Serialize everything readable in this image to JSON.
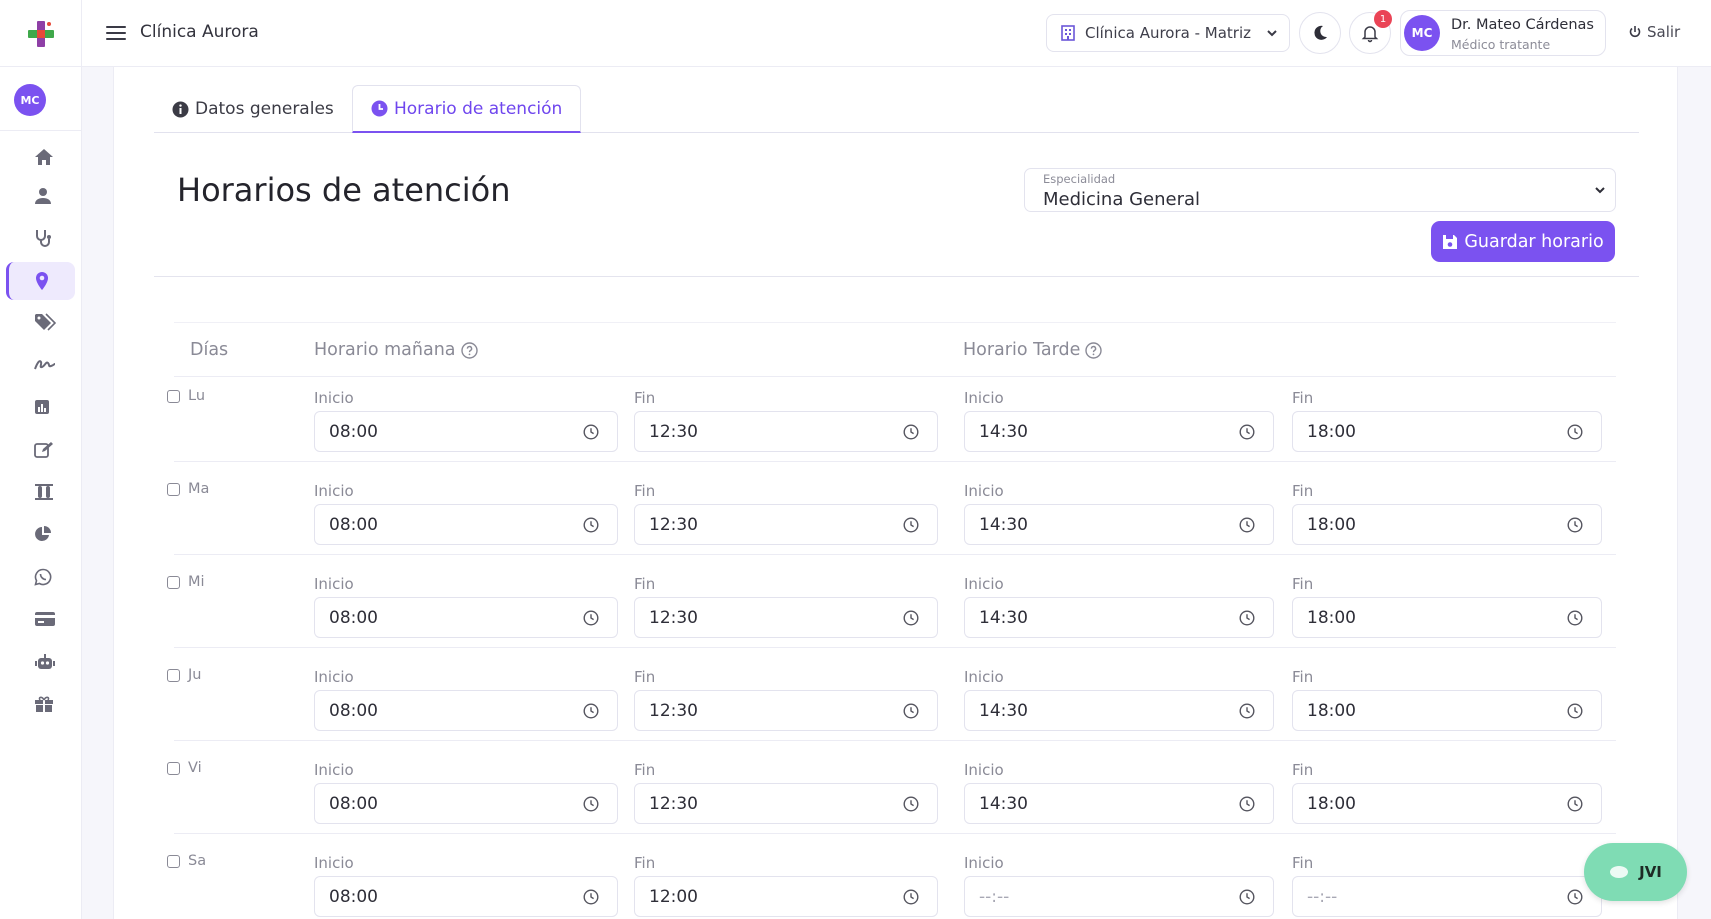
{
  "header": {
    "app_title": "Clínica Aurora",
    "branch": "Clínica Aurora - Matriz",
    "notification_count": "1",
    "user_initials": "MC",
    "user_name": "Dr. Mateo Cárdenas",
    "user_role": "Médico tratante",
    "logout_label": "Salir"
  },
  "sidebar": {
    "avatar_initials": "MC",
    "items": [
      {
        "icon": "home-icon"
      },
      {
        "icon": "user-icon"
      },
      {
        "icon": "stethoscope-icon"
      },
      {
        "icon": "location-pin-icon",
        "active": true
      },
      {
        "icon": "tags-icon"
      },
      {
        "icon": "signature-icon"
      },
      {
        "icon": "bar-chart-icon"
      },
      {
        "icon": "edit-icon"
      },
      {
        "icon": "test-tubes-icon"
      },
      {
        "icon": "pie-chart-icon"
      },
      {
        "icon": "whatsapp-icon"
      },
      {
        "icon": "credit-card-icon"
      },
      {
        "icon": "robot-icon"
      },
      {
        "icon": "gift-icon"
      }
    ]
  },
  "tabs": [
    {
      "label": "Datos generales",
      "icon": "info-icon"
    },
    {
      "label": "Horario de atención",
      "icon": "clock-icon",
      "active": true
    }
  ],
  "page_title": "Horarios de atención",
  "specialty": {
    "label": "Especialidad",
    "value": "Medicina General"
  },
  "save_label": "Guardar horario",
  "table": {
    "col_days": "Días",
    "col_morning": "Horario mañana",
    "col_afternoon": "Horario Tarde",
    "start_label": "Inicio",
    "end_label": "Fin",
    "rows": [
      {
        "day": "Lu",
        "m_start": "08:00",
        "m_end": "12:30",
        "a_start": "14:30",
        "a_end": "18:00"
      },
      {
        "day": "Ma",
        "m_start": "08:00",
        "m_end": "12:30",
        "a_start": "14:30",
        "a_end": "18:00"
      },
      {
        "day": "Mi",
        "m_start": "08:00",
        "m_end": "12:30",
        "a_start": "14:30",
        "a_end": "18:00"
      },
      {
        "day": "Ju",
        "m_start": "08:00",
        "m_end": "12:30",
        "a_start": "14:30",
        "a_end": "18:00"
      },
      {
        "day": "Vi",
        "m_start": "08:00",
        "m_end": "12:30",
        "a_start": "14:30",
        "a_end": "18:00"
      },
      {
        "day": "Sa",
        "m_start": "08:00",
        "m_end": "12:00",
        "a_start": "--:--",
        "a_end": "--:--"
      }
    ]
  },
  "assistant_label": "JVI",
  "colors": {
    "accent": "#7b52f0",
    "assistant": "#7fdcb4",
    "badge": "#ea4456"
  }
}
